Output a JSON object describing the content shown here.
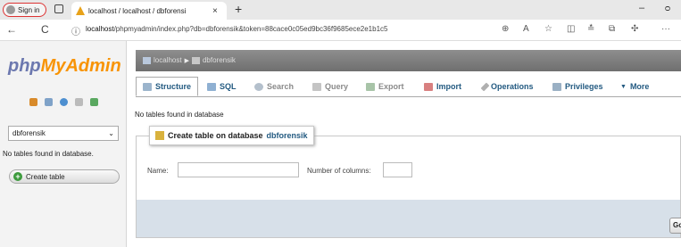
{
  "browser": {
    "signin_label": "Sign in",
    "tab_title": "localhost / localhost / dbforensi",
    "tab_close": "×",
    "new_tab": "+",
    "url_host": "localhost",
    "url_rest": "/phpmyadmin/index.php?db=dbforensik&token=88cace0c05ed9bc36f9685ece2e1b1c5",
    "back": "←",
    "reload": "C",
    "info": "ⓘ",
    "minimize": "–",
    "restore": "ᴑ",
    "more": "···"
  },
  "sidebar": {
    "logo_php": "php",
    "logo_my": "MyAdmin",
    "db_selected": "dbforensik",
    "no_tables": "No tables found in database.",
    "create_table": "Create table"
  },
  "breadcrumb": {
    "server": "localhost",
    "database": "dbforensik"
  },
  "tabs": [
    {
      "label": "Structure",
      "icon": "structure-icon",
      "active": true
    },
    {
      "label": "SQL",
      "icon": "sql-icon"
    },
    {
      "label": "Search",
      "icon": "search-icon"
    },
    {
      "label": "Query",
      "icon": "query-icon"
    },
    {
      "label": "Export",
      "icon": "export-icon"
    },
    {
      "label": "Import",
      "icon": "import-icon"
    },
    {
      "label": "Operations",
      "icon": "operations-icon"
    },
    {
      "label": "Privileges",
      "icon": "privileges-icon"
    },
    {
      "label": "More",
      "icon": "chevron-down-icon"
    }
  ],
  "main": {
    "no_tables": "No tables found in database",
    "create_legend": "Create table on database",
    "create_db": "dbforensik",
    "name_label": "Name:",
    "columns_label": "Number of columns:",
    "go_label": "Go"
  },
  "colors": {
    "accent": "#235a81",
    "logo_blue": "#6c78af",
    "logo_orange": "#f89406",
    "footer_bg": "#d7e0e9"
  }
}
